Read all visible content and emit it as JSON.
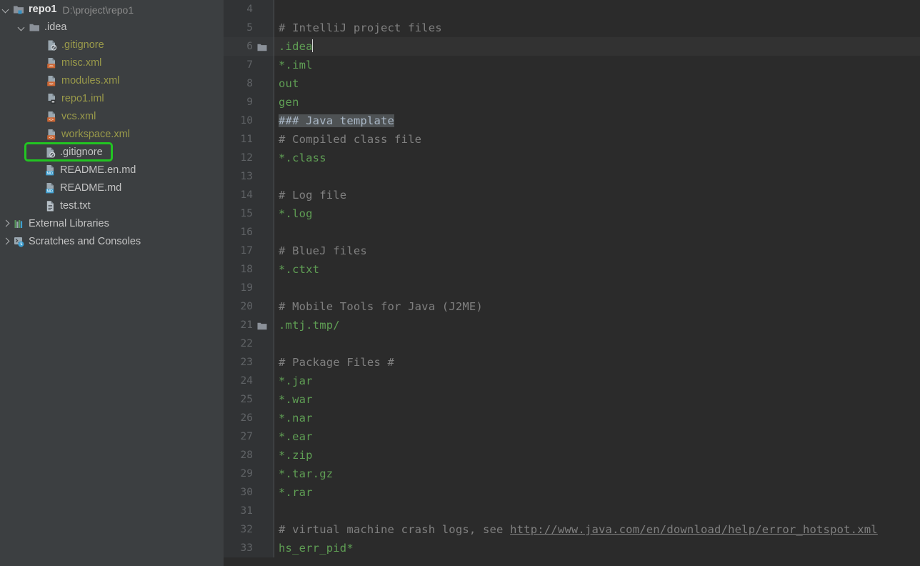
{
  "sidebar": {
    "name": "project-tree",
    "items": [
      {
        "label": "repo1",
        "sub": "D:\\project\\repo1",
        "icon": "module-folder-icon",
        "twisty": "down",
        "level": 0,
        "style": "bold",
        "name": "tree-item-repo1"
      },
      {
        "label": ".idea",
        "sub": "",
        "icon": "folder-icon",
        "twisty": "down",
        "level": 1,
        "style": "plain",
        "name": "tree-item-idea"
      },
      {
        "label": ".gitignore",
        "sub": "",
        "icon": "gitignore-file-icon",
        "twisty": "none",
        "level": 2,
        "style": "ignored",
        "name": "tree-item-idea-gitignore"
      },
      {
        "label": "misc.xml",
        "sub": "",
        "icon": "xml-file-icon",
        "twisty": "none",
        "level": 2,
        "style": "ignored",
        "name": "tree-item-misc-xml"
      },
      {
        "label": "modules.xml",
        "sub": "",
        "icon": "xml-file-icon",
        "twisty": "none",
        "level": 2,
        "style": "ignored",
        "name": "tree-item-modules-xml"
      },
      {
        "label": "repo1.iml",
        "sub": "",
        "icon": "iml-file-icon",
        "twisty": "none",
        "level": 2,
        "style": "ignored",
        "name": "tree-item-repo1-iml"
      },
      {
        "label": "vcs.xml",
        "sub": "",
        "icon": "xml-file-icon",
        "twisty": "none",
        "level": 2,
        "style": "ignored",
        "name": "tree-item-vcs-xml"
      },
      {
        "label": "workspace.xml",
        "sub": "",
        "icon": "xml-file-icon",
        "twisty": "none",
        "level": 2,
        "style": "ignored",
        "name": "tree-item-workspace-xml"
      },
      {
        "label": ".gitignore",
        "sub": "",
        "icon": "gitignore-file-icon",
        "twisty": "none",
        "level": "1b",
        "style": "plain",
        "name": "tree-item-root-gitignore",
        "highlighted": true
      },
      {
        "label": "README.en.md",
        "sub": "",
        "icon": "markdown-file-icon",
        "twisty": "none",
        "level": "1b",
        "style": "plain",
        "name": "tree-item-readme-en-md"
      },
      {
        "label": "README.md",
        "sub": "",
        "icon": "markdown-file-icon",
        "twisty": "none",
        "level": "1b",
        "style": "plain",
        "name": "tree-item-readme-md"
      },
      {
        "label": "test.txt",
        "sub": "",
        "icon": "text-file-icon",
        "twisty": "none",
        "level": "1b",
        "style": "plain",
        "name": "tree-item-test-txt"
      },
      {
        "label": "External Libraries",
        "sub": "",
        "icon": "libraries-icon",
        "twisty": "right",
        "level": 0,
        "style": "plain",
        "name": "tree-item-external-libraries"
      },
      {
        "label": "Scratches and Consoles",
        "sub": "",
        "icon": "scratches-icon",
        "twisty": "right",
        "level": 0,
        "style": "plain",
        "name": "tree-item-scratches-and-consoles"
      }
    ],
    "annotation_color": "#22c522"
  },
  "editor": {
    "name": "gitignore-editor",
    "caret_line": 6,
    "first_visible_line": 4,
    "lines": [
      {
        "num": 4,
        "gutter_icon": "",
        "tokens": []
      },
      {
        "num": 5,
        "gutter_icon": "",
        "tokens": [
          {
            "t": "# IntelliJ project files",
            "c": "cm"
          }
        ]
      },
      {
        "num": 6,
        "gutter_icon": "folder-icon",
        "tokens": [
          {
            "t": ".idea",
            "c": "pat"
          }
        ],
        "caret": true
      },
      {
        "num": 7,
        "gutter_icon": "",
        "tokens": [
          {
            "t": "*.iml",
            "c": "pat"
          }
        ]
      },
      {
        "num": 8,
        "gutter_icon": "",
        "tokens": [
          {
            "t": "out",
            "c": "pat"
          }
        ]
      },
      {
        "num": 9,
        "gutter_icon": "",
        "tokens": [
          {
            "t": "gen",
            "c": "pat"
          }
        ]
      },
      {
        "num": 10,
        "gutter_icon": "",
        "tokens": [
          {
            "t": "### Java template",
            "c": "hl"
          }
        ]
      },
      {
        "num": 11,
        "gutter_icon": "",
        "tokens": [
          {
            "t": "# Compiled class file",
            "c": "cm"
          }
        ]
      },
      {
        "num": 12,
        "gutter_icon": "",
        "tokens": [
          {
            "t": "*.class",
            "c": "pat"
          }
        ]
      },
      {
        "num": 13,
        "gutter_icon": "",
        "tokens": []
      },
      {
        "num": 14,
        "gutter_icon": "",
        "tokens": [
          {
            "t": "# Log file",
            "c": "cm"
          }
        ]
      },
      {
        "num": 15,
        "gutter_icon": "",
        "tokens": [
          {
            "t": "*.log",
            "c": "pat"
          }
        ]
      },
      {
        "num": 16,
        "gutter_icon": "",
        "tokens": []
      },
      {
        "num": 17,
        "gutter_icon": "",
        "tokens": [
          {
            "t": "# BlueJ files",
            "c": "cm"
          }
        ]
      },
      {
        "num": 18,
        "gutter_icon": "",
        "tokens": [
          {
            "t": "*.ctxt",
            "c": "pat"
          }
        ]
      },
      {
        "num": 19,
        "gutter_icon": "",
        "tokens": []
      },
      {
        "num": 20,
        "gutter_icon": "",
        "tokens": [
          {
            "t": "# Mobile Tools for Java (J2ME)",
            "c": "cm"
          }
        ]
      },
      {
        "num": 21,
        "gutter_icon": "folder-icon",
        "tokens": [
          {
            "t": ".mtj.tmp/",
            "c": "pat"
          }
        ]
      },
      {
        "num": 22,
        "gutter_icon": "",
        "tokens": []
      },
      {
        "num": 23,
        "gutter_icon": "",
        "tokens": [
          {
            "t": "# Package Files #",
            "c": "cm"
          }
        ]
      },
      {
        "num": 24,
        "gutter_icon": "",
        "tokens": [
          {
            "t": "*.jar",
            "c": "pat"
          }
        ]
      },
      {
        "num": 25,
        "gutter_icon": "",
        "tokens": [
          {
            "t": "*.war",
            "c": "pat"
          }
        ]
      },
      {
        "num": 26,
        "gutter_icon": "",
        "tokens": [
          {
            "t": "*.nar",
            "c": "pat"
          }
        ]
      },
      {
        "num": 27,
        "gutter_icon": "",
        "tokens": [
          {
            "t": "*.ear",
            "c": "pat"
          }
        ]
      },
      {
        "num": 28,
        "gutter_icon": "",
        "tokens": [
          {
            "t": "*.zip",
            "c": "pat"
          }
        ]
      },
      {
        "num": 29,
        "gutter_icon": "",
        "tokens": [
          {
            "t": "*.tar.gz",
            "c": "pat"
          }
        ]
      },
      {
        "num": 30,
        "gutter_icon": "",
        "tokens": [
          {
            "t": "*.rar",
            "c": "pat"
          }
        ]
      },
      {
        "num": 31,
        "gutter_icon": "",
        "tokens": []
      },
      {
        "num": 32,
        "gutter_icon": "",
        "tokens": [
          {
            "t": "# virtual machine crash logs, see ",
            "c": "cm"
          },
          {
            "t": "http://www.java.com/en/download/help/error_hotspot.xml",
            "c": "link"
          }
        ]
      },
      {
        "num": 33,
        "gutter_icon": "",
        "tokens": [
          {
            "t": "hs_err_pid*",
            "c": "pat"
          }
        ]
      }
    ]
  },
  "colors": {
    "sidebar_bg": "#3c3f41",
    "editor_bg": "#2b2b2b",
    "gutter_bg": "#313335",
    "caret_row_bg": "#323232",
    "comment": "#808080",
    "pattern": "#5f9e54",
    "ignored_file": "#9a9a4a",
    "annotation": "#22c522"
  }
}
